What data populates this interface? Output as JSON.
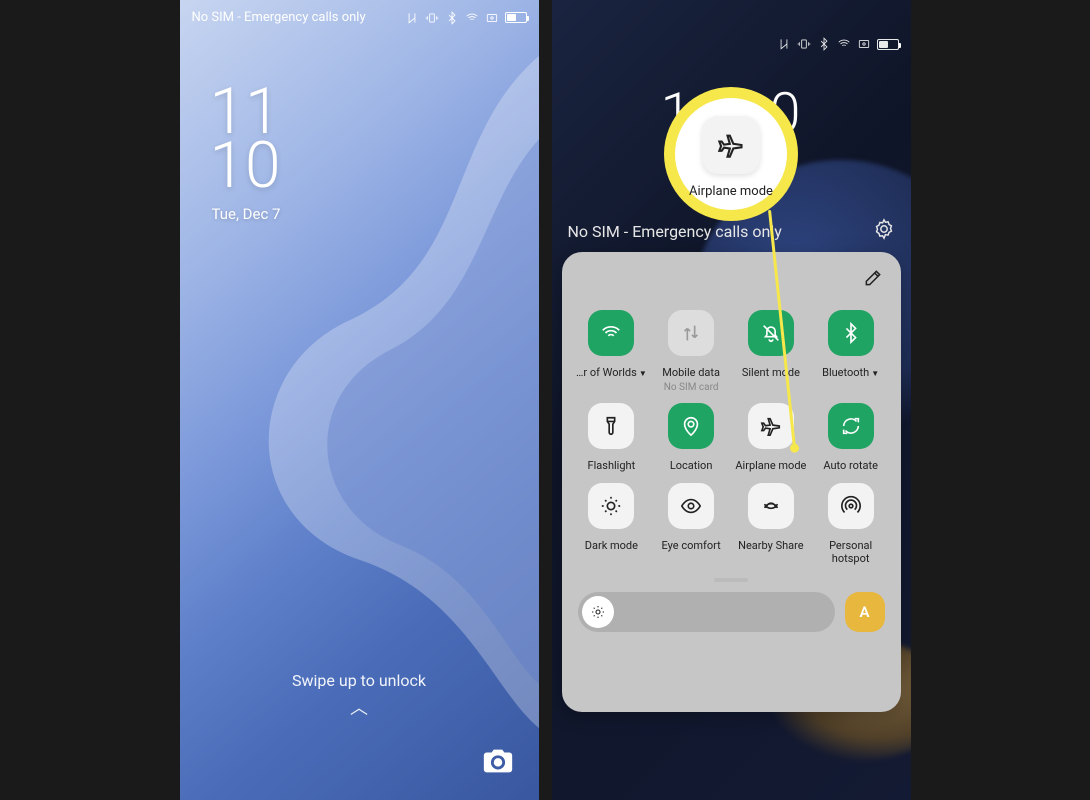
{
  "left": {
    "status_text": "No SIM - Emergency calls only",
    "clock_hh": "11",
    "clock_mm": "10",
    "date": "Tue, Dec 7",
    "unlock_hint": "Swipe up to unlock"
  },
  "right": {
    "clock": "11:10",
    "sim_notice": "No SIM - Emergency calls only",
    "callout_label": "Airplane mode",
    "auto_brightness_label": "A",
    "tiles": [
      {
        "label": "…r of Worlds",
        "caret": true,
        "state": "on",
        "icon": "wifi"
      },
      {
        "label": "Mobile data",
        "sub": "No SIM card",
        "state": "disabled",
        "icon": "mobile-data"
      },
      {
        "label": "Silent mode",
        "state": "on",
        "icon": "bell-off"
      },
      {
        "label": "Bluetooth",
        "caret": true,
        "state": "on",
        "icon": "bluetooth"
      },
      {
        "label": "Flashlight",
        "state": "off",
        "icon": "flashlight"
      },
      {
        "label": "Location",
        "state": "on",
        "icon": "location"
      },
      {
        "label": "Airplane mode",
        "state": "off",
        "icon": "airplane"
      },
      {
        "label": "Auto rotate",
        "state": "on",
        "icon": "rotate"
      },
      {
        "label": "Dark mode",
        "state": "off",
        "icon": "dark-mode"
      },
      {
        "label": "Eye comfort",
        "state": "off",
        "icon": "eye"
      },
      {
        "label": "Nearby Share",
        "state": "off",
        "icon": "nearby"
      },
      {
        "label": "Personal hotspot",
        "state": "off",
        "icon": "hotspot"
      }
    ]
  }
}
